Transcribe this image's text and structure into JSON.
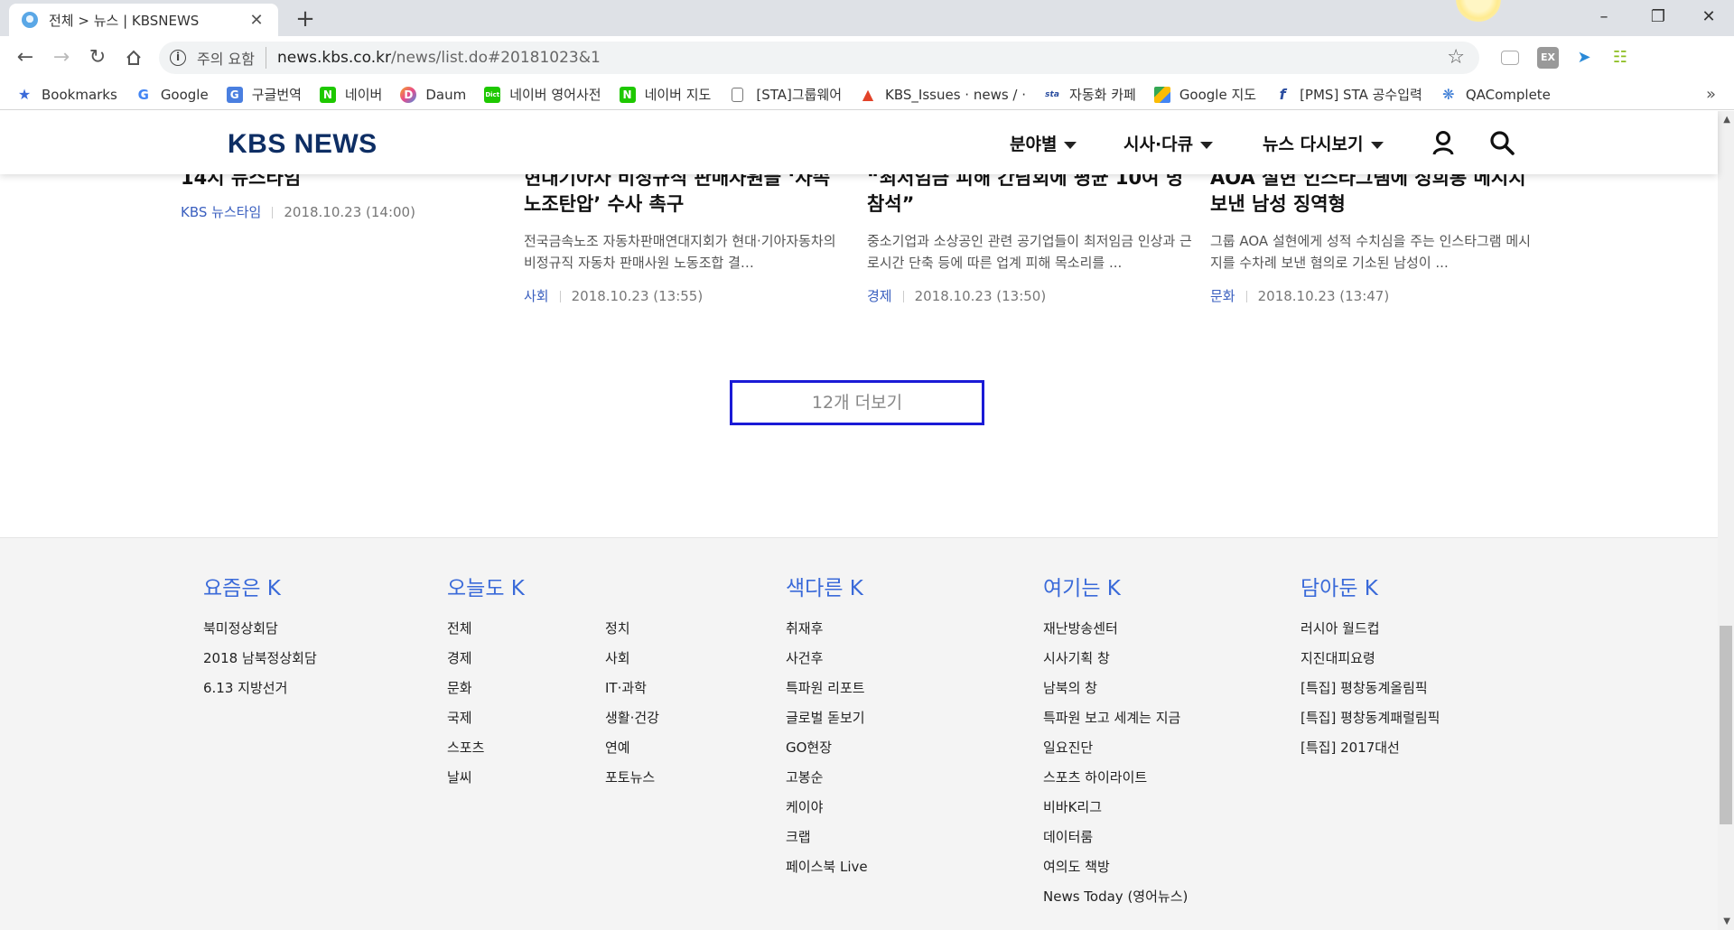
{
  "browser": {
    "tab_title": "전체 > 뉴스 | KBSNEWS",
    "tab_close": "✕",
    "new_tab": "+",
    "security_label": "주의 요함",
    "url_host": "news.kbs.co.kr",
    "url_path": "/news/list.do#20181023&1",
    "bookmarks": [
      {
        "label": "Bookmarks",
        "icon": "star-icon"
      },
      {
        "label": "Google",
        "icon": "google-icon"
      },
      {
        "label": "구글번역",
        "icon": "translate-icon"
      },
      {
        "label": "네이버",
        "icon": "naver-icon"
      },
      {
        "label": "Daum",
        "icon": "daum-icon"
      },
      {
        "label": "네이버 영어사전",
        "icon": "dict-icon"
      },
      {
        "label": "네이버 지도",
        "icon": "naver-icon"
      },
      {
        "label": "[STA]그룹웨어",
        "icon": "page-icon"
      },
      {
        "label": "KBS_Issues · news / ·",
        "icon": "gitlab-icon"
      },
      {
        "label": "자동화 카페",
        "icon": "sta-icon"
      },
      {
        "label": "Google 지도",
        "icon": "maps-icon"
      },
      {
        "label": "[PMS] STA 공수입력",
        "icon": "pms-icon"
      },
      {
        "label": "QAComplete",
        "icon": "qa-icon"
      }
    ]
  },
  "header": {
    "logo": "KBS NEWS",
    "nav": [
      "분야별",
      "시사·다큐",
      "뉴스 다시보기"
    ]
  },
  "articles": [
    {
      "title": "14시 뉴스타임",
      "summary": "",
      "category": "KBS 뉴스타임",
      "date": "2018.10.23 (14:00)"
    },
    {
      "title": "현대기아차 비정규직 판매사원들 ‘자속 노조탄압’ 수사 촉구",
      "summary": "전국금속노조 자동차판매연대지회가 현대·기아자동차의 비정규직 자동차 판매사원 노동조합 결…",
      "category": "사회",
      "date": "2018.10.23 (13:55)"
    },
    {
      "title": "“최저임금 피해 간담회에 평균 10여 명 참석”",
      "summary": "중소기업과 소상공인 관련 공기업들이 최저임금 인상과 근로시간 단축 등에 따른 업계 피해 목소리를 ...",
      "category": "경제",
      "date": "2018.10.23 (13:50)"
    },
    {
      "title": "AOA 설현 인스타그램에 성희롱 메시지 보낸 남성 징역형",
      "summary": "그룹 AOA 설현에게 성적 수치심을 주는 인스타그램 메시지를 수차례 보낸 혐의로 기소된 남성이 ...",
      "category": "문화",
      "date": "2018.10.23 (13:47)"
    }
  ],
  "more_button": "12개 더보기",
  "footer": {
    "col1": {
      "head": "요즘은 K",
      "links": [
        "북미정상회담",
        "2018 남북정상회담",
        "6.13 지방선거"
      ]
    },
    "col2": {
      "head": "오늘도 K",
      "links_a": [
        "전체",
        "경제",
        "문화",
        "국제",
        "스포츠",
        "날씨"
      ],
      "links_b": [
        "정치",
        "사회",
        "IT·과학",
        "생활·건강",
        "연예",
        "포토뉴스"
      ]
    },
    "col3": {
      "head": "색다른 K",
      "links": [
        "취재후",
        "사건후",
        "특파원 리포트",
        "글로벌 돋보기",
        "GO현장",
        "고봉순",
        "케이야",
        "크랩",
        "페이스북 Live"
      ]
    },
    "col4": {
      "head": "여기는 K",
      "links": [
        "재난방송센터",
        "시사기획 창",
        "남북의 창",
        "특파원 보고 세계는 지금",
        "일요진단",
        "스포츠 하이라이트",
        "비바K리그",
        "데이터룸",
        "여의도 책방",
        "News Today (영어뉴스)"
      ]
    },
    "col5": {
      "head": "담아둔 K",
      "links": [
        "러시아 월드컵",
        "지진대피요령",
        "[특집] 평창동계올림픽",
        "[특집] 평창동계패럴림픽",
        "[특집] 2017대선"
      ]
    }
  }
}
